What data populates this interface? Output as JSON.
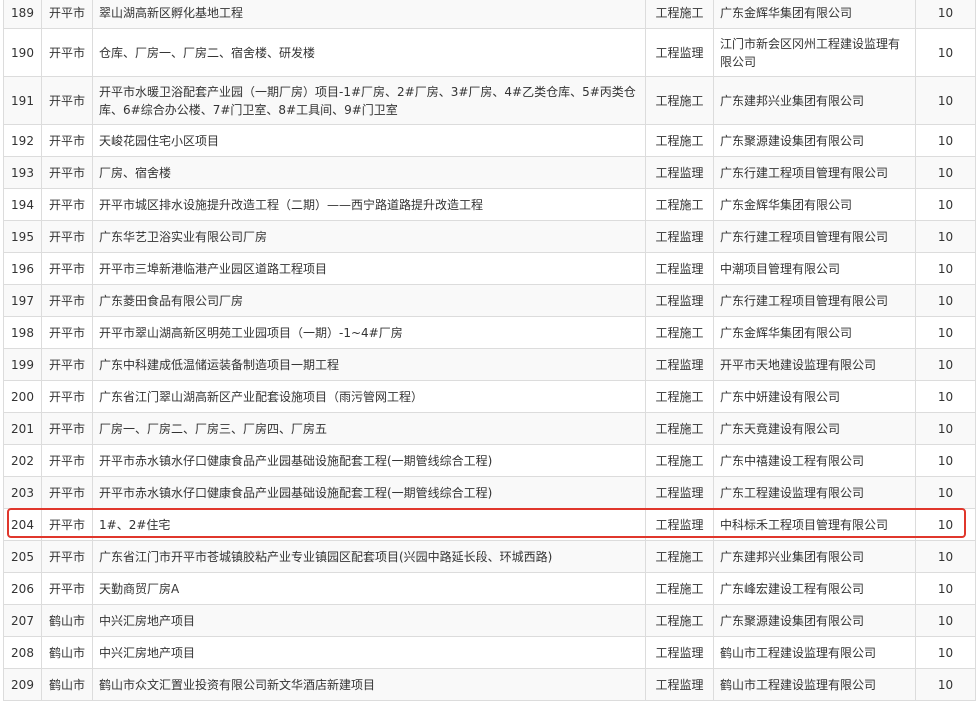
{
  "rows": [
    {
      "no": "189",
      "city": "开平市",
      "project": "翠山湖高新区孵化基地工程",
      "type": "工程施工",
      "company": "广东金辉华集团有限公司",
      "score": "10"
    },
    {
      "no": "190",
      "city": "开平市",
      "project": "仓库、厂房一、厂房二、宿舍楼、研发楼",
      "type": "工程监理",
      "company": "江门市新会区冈州工程建设监理有限公司",
      "score": "10"
    },
    {
      "no": "191",
      "city": "开平市",
      "project": "开平市水暖卫浴配套产业园（一期厂房）项目-1#厂房、2#厂房、3#厂房、4#乙类仓库、5#丙类仓库、6#综合办公楼、7#门卫室、8#工具间、9#门卫室",
      "type": "工程施工",
      "company": "广东建邦兴业集团有限公司",
      "score": "10"
    },
    {
      "no": "192",
      "city": "开平市",
      "project": "天峻花园住宅小区项目",
      "type": "工程施工",
      "company": "广东聚源建设集团有限公司",
      "score": "10"
    },
    {
      "no": "193",
      "city": "开平市",
      "project": "厂房、宿舍楼",
      "type": "工程监理",
      "company": "广东行建工程项目管理有限公司",
      "score": "10"
    },
    {
      "no": "194",
      "city": "开平市",
      "project": "开平市城区排水设施提升改造工程（二期）——西宁路道路提升改造工程",
      "type": "工程施工",
      "company": "广东金辉华集团有限公司",
      "score": "10"
    },
    {
      "no": "195",
      "city": "开平市",
      "project": "广东华艺卫浴实业有限公司厂房",
      "type": "工程监理",
      "company": "广东行建工程项目管理有限公司",
      "score": "10"
    },
    {
      "no": "196",
      "city": "开平市",
      "project": "开平市三埠新港临港产业园区道路工程项目",
      "type": "工程监理",
      "company": "中潮项目管理有限公司",
      "score": "10"
    },
    {
      "no": "197",
      "city": "开平市",
      "project": "广东菱田食品有限公司厂房",
      "type": "工程监理",
      "company": "广东行建工程项目管理有限公司",
      "score": "10"
    },
    {
      "no": "198",
      "city": "开平市",
      "project": "开平市翠山湖高新区明苑工业园项目（一期）-1~4#厂房",
      "type": "工程施工",
      "company": "广东金辉华集团有限公司",
      "score": "10"
    },
    {
      "no": "199",
      "city": "开平市",
      "project": "广东中科建成低温储运装备制造项目一期工程",
      "type": "工程监理",
      "company": "开平市天地建设监理有限公司",
      "score": "10"
    },
    {
      "no": "200",
      "city": "开平市",
      "project": "广东省江门翠山湖高新区产业配套设施项目（雨污管网工程）",
      "type": "工程施工",
      "company": "广东中妍建设有限公司",
      "score": "10"
    },
    {
      "no": "201",
      "city": "开平市",
      "project": "厂房一、厂房二、厂房三、厂房四、厂房五",
      "type": "工程施工",
      "company": "广东天竟建设有限公司",
      "score": "10"
    },
    {
      "no": "202",
      "city": "开平市",
      "project": "开平市赤水镇水仔口健康食品产业园基础设施配套工程(一期管线综合工程)",
      "type": "工程施工",
      "company": "广东中禧建设工程有限公司",
      "score": "10"
    },
    {
      "no": "203",
      "city": "开平市",
      "project": "开平市赤水镇水仔口健康食品产业园基础设施配套工程(一期管线综合工程)",
      "type": "工程监理",
      "company": "广东工程建设监理有限公司",
      "score": "10"
    },
    {
      "no": "204",
      "city": "开平市",
      "project": "1#、2#住宅",
      "type": "工程监理",
      "company": "中科标禾工程项目管理有限公司",
      "score": "10"
    },
    {
      "no": "205",
      "city": "开平市",
      "project": "广东省江门市开平市苍城镇胶粘产业专业镇园区配套项目(兴园中路延长段、环城西路)",
      "type": "工程施工",
      "company": "广东建邦兴业集团有限公司",
      "score": "10"
    },
    {
      "no": "206",
      "city": "开平市",
      "project": "天勤商贸厂房A",
      "type": "工程施工",
      "company": "广东峰宏建设工程有限公司",
      "score": "10"
    },
    {
      "no": "207",
      "city": "鹤山市",
      "project": "中兴汇房地产项目",
      "type": "工程施工",
      "company": "广东聚源建设集团有限公司",
      "score": "10"
    },
    {
      "no": "208",
      "city": "鹤山市",
      "project": "中兴汇房地产项目",
      "type": "工程监理",
      "company": "鹤山市工程建设监理有限公司",
      "score": "10"
    },
    {
      "no": "209",
      "city": "鹤山市",
      "project": "鹤山市众文汇置业投资有限公司新文华酒店新建项目",
      "type": "工程监理",
      "company": "鹤山市工程建设监理有限公司",
      "score": "10"
    }
  ],
  "highlight_row_no": "204",
  "colors": {
    "highlight_border": "#e0372c",
    "grid": "#dcdcdc",
    "text": "#333333",
    "odd_row": "#f9f9f9"
  }
}
